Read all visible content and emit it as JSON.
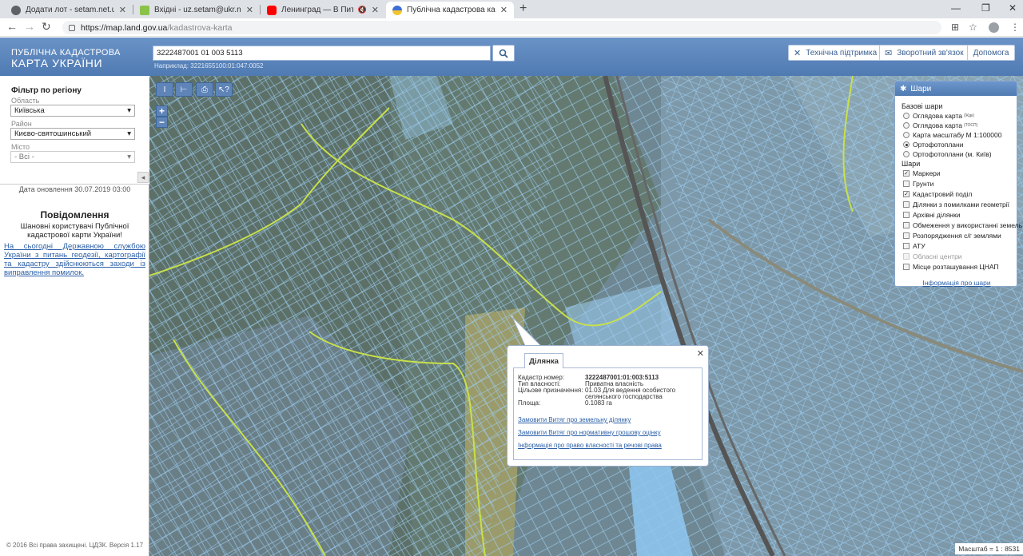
{
  "browser": {
    "tabs": [
      {
        "title": "Додати лот - setam.net.ua",
        "favicon_color": "#5f6368",
        "active": false
      },
      {
        "title": "Вхідні - uz.setam@ukr.net",
        "favicon_color": "#8bc34a",
        "active": false
      },
      {
        "title": "Ленинград — В Питере - п",
        "favicon_color": "#ff0000",
        "active": false
      },
      {
        "title": "Публічна кадастрова карта Укр",
        "favicon_color": "#f4c430",
        "active": true
      }
    ],
    "url_domain": "https://map.land.gov.ua",
    "url_path": "/kadastrova-karta"
  },
  "header": {
    "logo_line1": "ПУБЛІЧНА КАДАСТРОВА",
    "logo_line2": "КАРТА УКРАЇНИ",
    "search_value": "3222487001 01 003 5113",
    "search_hint": "Наприклад: 3221655100:01:047:0052",
    "buttons": {
      "support": "Технічна підтримка",
      "feedback": "Зворотний зв'язок",
      "help": "Допомога"
    }
  },
  "filter": {
    "title": "Фільтр по регіону",
    "oblast_label": "Область",
    "oblast_value": "Київська",
    "rayon_label": "Район",
    "rayon_value": "Києво-святошинський",
    "city_label": "Місто",
    "city_value": "- Всі -"
  },
  "sidebar": {
    "update_date": "Дата оновлення  30.07.2019 03:00",
    "msg_title": "Повідомлення",
    "msg_body": "Шановні користувачі Публічної кадастрової карти України!",
    "msg_link": "На сьогодні Державною службою України з питань геодезії, картографії та кадастру здійснюються заходи із виправлення помилок.",
    "copyright": "© 2016 Всі права захищені. ЦДЗК. Версія 1.17"
  },
  "layers": {
    "title": "Шари",
    "base_title": "Базові шари",
    "base": [
      {
        "label": "Оглядова карта",
        "sup": "(Ждк)",
        "on": false
      },
      {
        "label": "Оглядова карта",
        "sup": "(ТОСП)",
        "on": false
      },
      {
        "label": "Карта масштабу М 1:100000",
        "sup": "",
        "on": false
      },
      {
        "label": "Ортофотоплани",
        "sup": "",
        "on": true
      },
      {
        "label": "Ортофотоплани (м. Київ)",
        "sup": "",
        "on": false
      }
    ],
    "overlay_title": "Шари",
    "overlays": [
      {
        "label": "Маркери",
        "checked": true,
        "disabled": false
      },
      {
        "label": "Грунти",
        "checked": false,
        "disabled": false
      },
      {
        "label": "Кадастровий поділ",
        "checked": true,
        "disabled": false
      },
      {
        "label": "Ділянки з помилками геометрії",
        "checked": false,
        "disabled": false
      },
      {
        "label": "Архівні ділянки",
        "checked": false,
        "disabled": false
      },
      {
        "label": "Обмеження у використанні земель",
        "checked": false,
        "disabled": false
      },
      {
        "label": "Розпорядження с/г землями",
        "checked": false,
        "disabled": false
      },
      {
        "label": "АТУ",
        "checked": false,
        "disabled": false
      },
      {
        "label": "Обласні центри",
        "checked": false,
        "disabled": true
      },
      {
        "label": "Місце розташування ЦНАП",
        "checked": false,
        "disabled": false
      }
    ],
    "info_link": "Інформація про шари"
  },
  "popup": {
    "tab": "Ділянка",
    "rows": [
      {
        "key": "Кадастр.номер:",
        "value": "3222487001:01:003:5113"
      },
      {
        "key": "Тип власності:",
        "value": "Приватна власність"
      },
      {
        "key": "Цільове призначення:",
        "value": "01.03 Для ведення особистого селянського господарства"
      },
      {
        "key": "Площа:",
        "value": "0.1083 га"
      }
    ],
    "links": [
      "Замовити Витяг про земельну ділянку",
      "Замовити Витяг про нормативну грошову оцінку",
      "Інформація про право власності та речові права"
    ]
  },
  "map": {
    "scale": "Масштаб = 1 : 8531",
    "tools": [
      "measure-length",
      "measure-area",
      "print",
      "identify"
    ],
    "zoom_in": "+",
    "zoom_out": "−",
    "parcel_color": "#8fc8f2",
    "boundary_color": "#c8e04a"
  }
}
